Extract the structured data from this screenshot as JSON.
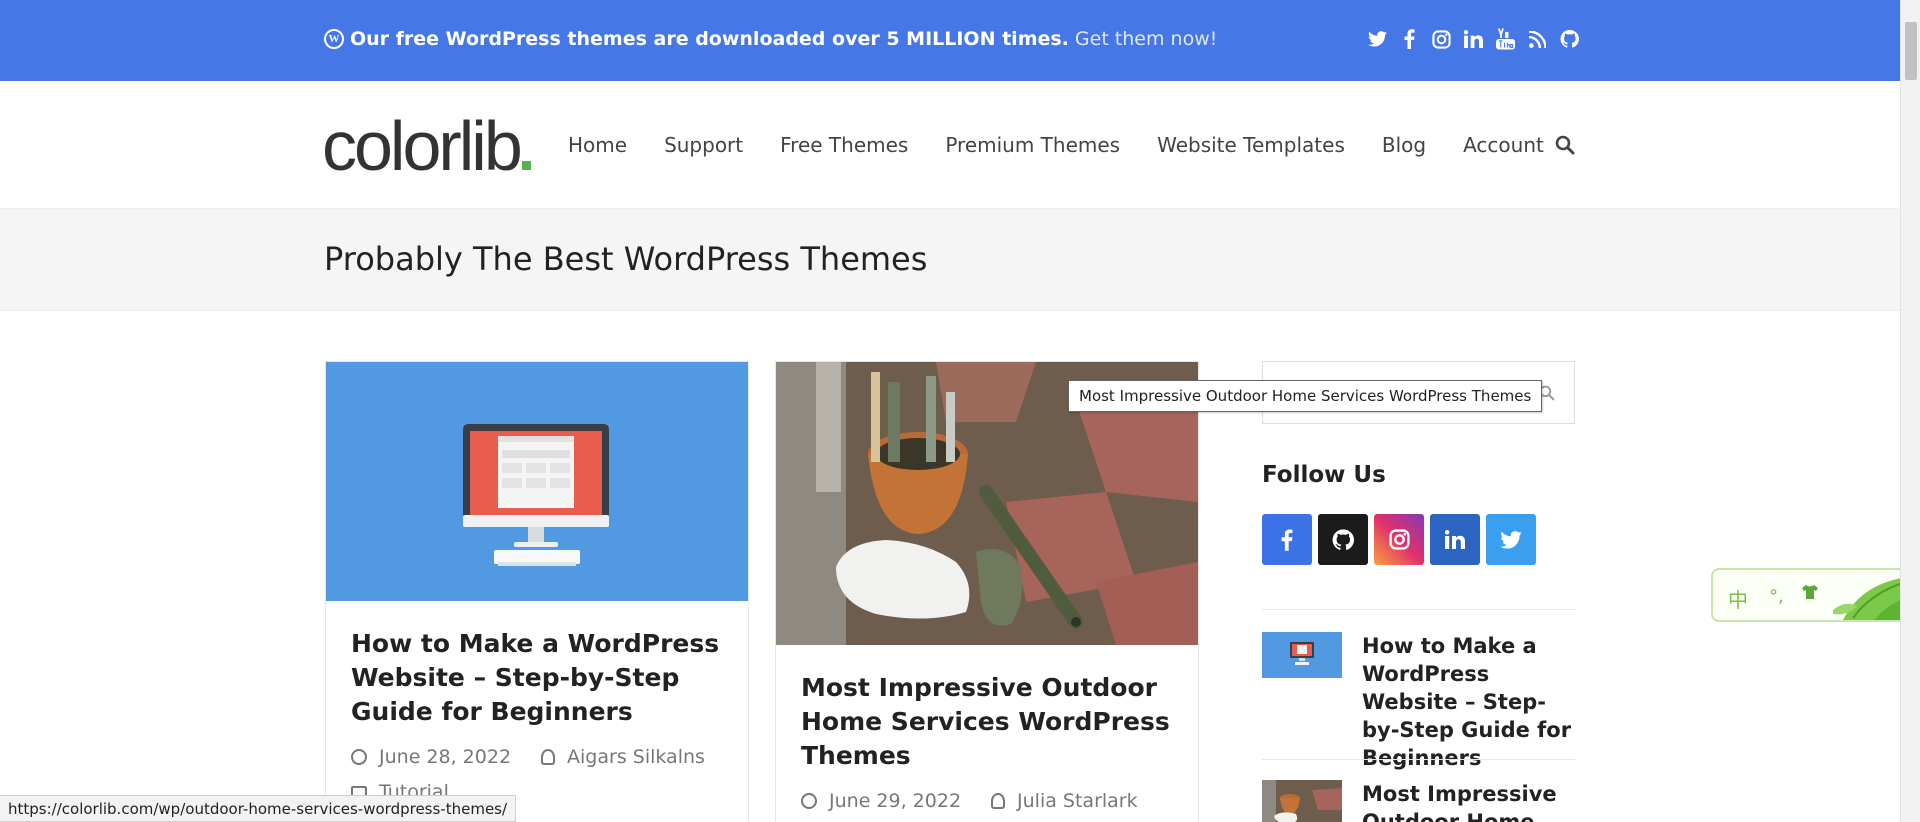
{
  "banner": {
    "promo_text": "Our free WordPress themes are downloaded over 5 MILLION times.",
    "promo_link": "Get them now!",
    "background": "#4577e6",
    "social_icons": [
      "twitter-icon",
      "facebook-icon",
      "instagram-icon",
      "linkedin-icon",
      "youtube-icon",
      "rss-icon",
      "github-icon"
    ]
  },
  "header": {
    "logo_text": "colorlib",
    "logo_accent": "#55b14b",
    "nav": [
      "Home",
      "Support",
      "Free Themes",
      "Premium Themes",
      "Website Templates",
      "Blog",
      "Account"
    ]
  },
  "page_title": "Probably The Best WordPress Themes",
  "posts": [
    {
      "title": "How to Make a WordPress Website – Step-by-Step Guide for Beginners",
      "date": "June 28, 2022",
      "author": "Aigars Silkalns",
      "category": "Tutorial"
    },
    {
      "title": "Most Impressive Outdoor Home Services WordPress Themes",
      "date": "June 29, 2022",
      "author": "Julia Starlark"
    }
  ],
  "sidebar": {
    "search_placeholder": "",
    "tooltip": "Most Impressive Outdoor Home Services WordPress Themes",
    "follow_title": "Follow Us",
    "follow_icons": [
      {
        "icon": "facebook-icon",
        "color": "#3b72e8"
      },
      {
        "icon": "github-icon",
        "color": "#1b1b1b"
      },
      {
        "icon": "instagram-icon",
        "color": "#c13584"
      },
      {
        "icon": "linkedin-icon",
        "color": "#2c64c2"
      },
      {
        "icon": "twitter-icon",
        "color": "#3b9fef"
      }
    ],
    "recent_posts": [
      "How to Make a WordPress Website – Step-by-Step Guide for Beginners",
      "Most Impressive Outdoor Home"
    ]
  },
  "ime": {
    "label": "中"
  },
  "status_url": "https://colorlib.com/wp/outdoor-home-services-wordpress-themes/"
}
